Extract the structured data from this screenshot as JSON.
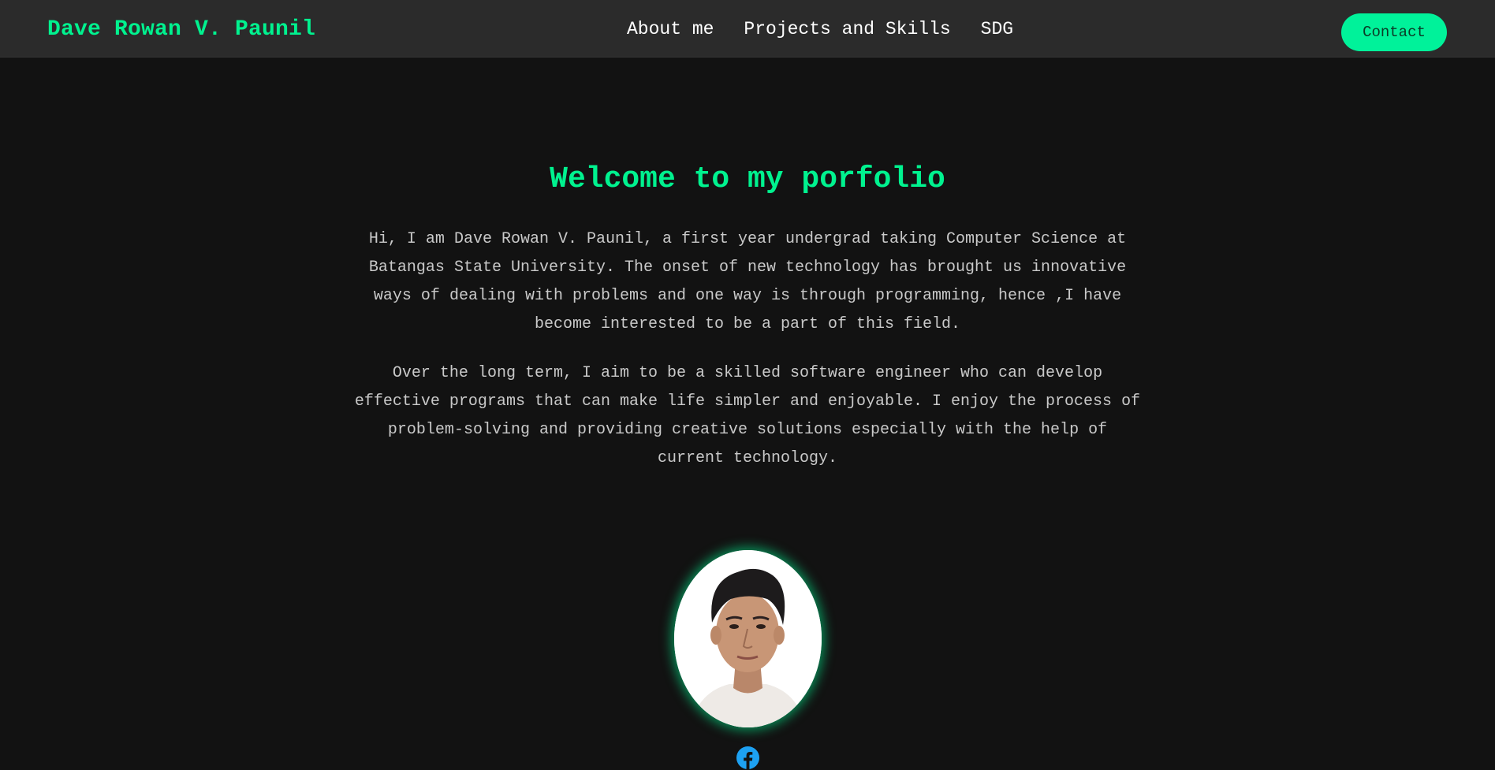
{
  "header": {
    "brand": "Dave Rowan V. Paunil",
    "nav": [
      {
        "label": "About me"
      },
      {
        "label": "Projects and Skills"
      },
      {
        "label": "SDG"
      }
    ],
    "contact_label": "Contact"
  },
  "hero": {
    "title": "Welcome to my porfolio",
    "paragraphs": [
      "Hi, I am Dave Rowan V. Paunil, a first year undergrad taking Computer Science at Batangas State University. The onset of new technology has brought us innovative ways of dealing with problems and one way is through programming, hence ,I have become interested to be a part of this field.",
      "Over the long term, I aim to be a skilled software engineer who can develop effective programs that can make life simpler and enjoyable. I enjoy the process of problem-solving and providing creative solutions especially with the help of current technology."
    ]
  },
  "social": {
    "icon": "facebook-icon"
  },
  "colors": {
    "accent": "#00f28f",
    "background": "#121212",
    "navbar": "#2b2b2b",
    "facebook": "#1877f2"
  }
}
